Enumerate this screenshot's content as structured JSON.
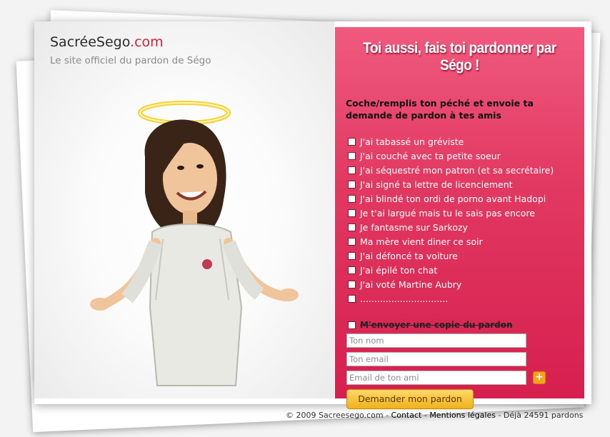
{
  "brand": {
    "name_part1": "SacréeSego",
    "name_part2": ".com",
    "tagline": "Le site officiel du pardon de Ségo"
  },
  "form": {
    "headline": "Toi aussi, fais toi pardonner par Ségo !",
    "instructions": "Coche/remplis ton péché et envoie ta demande de pardon à tes amis",
    "sins": [
      "J'ai tabassé un gréviste",
      "J'ai couché avec ta petite soeur",
      "J'ai séquestré mon patron (et sa secrétaire)",
      "J'ai signé ta lettre de licenciement",
      "J'ai blindé ton ordi de porno avant Hadopi",
      "Je t'ai largué mais tu le sais pas encore",
      "Je fantasme sur Sarkozy",
      "Ma mère vient diner ce soir",
      "J'ai défoncé ta voiture",
      "J'ai épilé ton chat",
      "J'ai voté Martine Aubry",
      "..............................."
    ],
    "copy_label": "M'envoyer une copie du pardon",
    "name_placeholder": "Ton nom",
    "email_placeholder": "Ton email",
    "friend_placeholder": "Email de ton ami",
    "add_symbol": "+",
    "submit_label": "Demander mon pardon"
  },
  "footer": {
    "copyright": "© 2009 Sacreesego.com - ",
    "contact": "Contact",
    "sep": " - ",
    "legal": "Mentions légales",
    "count_text": " - Déjà 24591 pardons"
  },
  "colors": {
    "accent": "#d61f4e",
    "button": "#f0b21a"
  }
}
